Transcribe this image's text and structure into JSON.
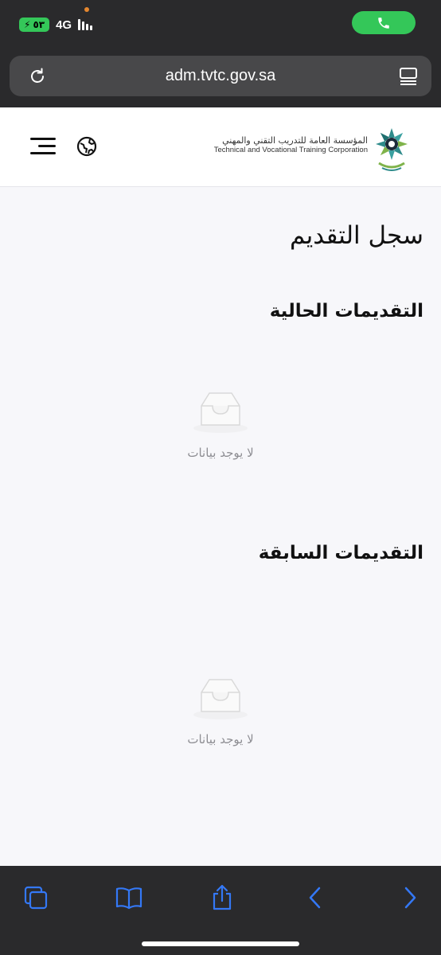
{
  "status_bar": {
    "battery_level": "٥٣",
    "network": "4G",
    "call_icon": "phone-icon"
  },
  "browser": {
    "url": "adm.tvtc.gov.sa"
  },
  "site": {
    "org_name_ar": "المؤسسة العامة للتدريب التقني والمهني",
    "org_name_en": "Technical and Vocational Training Corporation"
  },
  "main": {
    "page_title": "سجل التقديم",
    "current_section_title": "التقديمات الحالية",
    "previous_section_title": "التقديمات السابقة",
    "empty_text_current": "لا يوجد بيانات",
    "empty_text_previous": "لا يوجد بيانات"
  },
  "colors": {
    "accent": "#3478f6",
    "call_green": "#34c759",
    "chrome_bg": "#2a2a2c"
  }
}
